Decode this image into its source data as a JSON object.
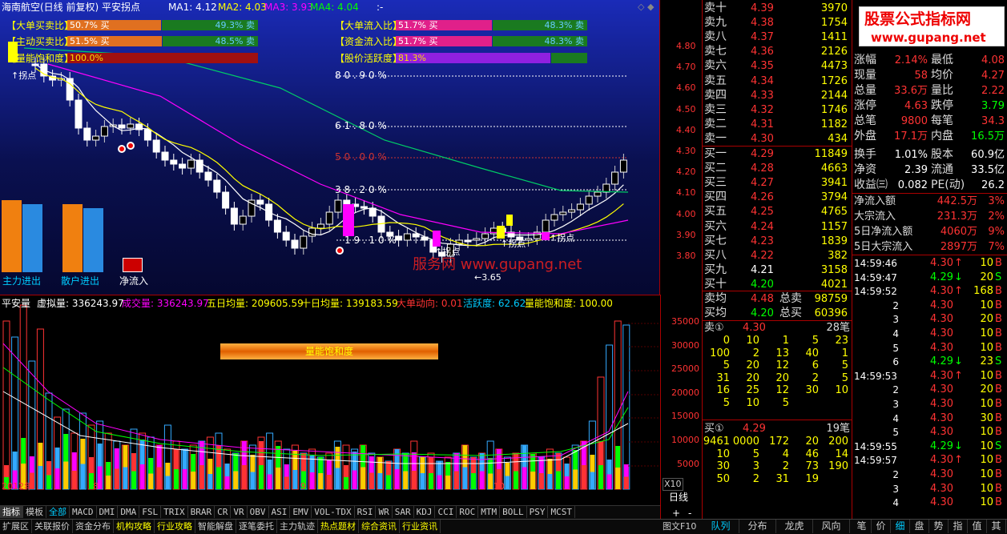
{
  "header": {
    "stock": "海南航空(日线 前复权) 平安拐点",
    "ma1": "MA1: 4.12",
    "ma2": "MA2: 4.03",
    "ma3": "MA3: 3.93",
    "ma4": "MA4: 4.04",
    "dash": ":-"
  },
  "indicators_left": [
    {
      "label": "【大单买卖比】",
      "bar": "50.7% 买",
      "right": "49.3% 卖"
    },
    {
      "label": "【主动买卖比】",
      "bar": "51.5% 买",
      "right": "48.5% 卖"
    },
    {
      "label": "【量能饱和度】",
      "bar": "100.0%",
      "right": ""
    }
  ],
  "indicators_right": [
    {
      "label": "【大单流入比】",
      "bar": "51.7% 买",
      "right": "48.3% 卖"
    },
    {
      "label": "【资金流入比】",
      "bar": "51.7% 买",
      "right": "48.3% 卖"
    },
    {
      "label": "【股价活跃度】",
      "bar": "81.3%",
      "right": ""
    }
  ],
  "price_axis": [
    "4.80",
    "4.70",
    "4.60",
    "4.50",
    "4.40",
    "4.30",
    "4.20",
    "4.10",
    "4.00",
    "3.90",
    "3.80"
  ],
  "fib": [
    "8 0 . 9 0 %",
    "6 1 . 8 0 %",
    "5 0 . 0 0 %",
    "3 8 . 2 0 %",
    "1 9 . 1 0 %"
  ],
  "annotations": {
    "turn1": "↑拐点",
    "turn2": "↑拐点",
    "turn3": "↑拐点",
    "turn4": "↑拐点",
    "low": "3.65"
  },
  "legend_bars": [
    "主力进出",
    "散户进出",
    "净流入"
  ],
  "watermark1": "服务网 www.gupang.net",
  "vol_header": {
    "name": "平安量",
    "v1": "虚拟量: 336243.97",
    "v2": "成交量: 336243.97",
    "v3": "五日均量: 209605.59",
    "v4": "十日均量: 139183.59",
    "v5": "大单动向: 0.01",
    "v6": "活跃度: 62.62",
    "v7": "量能饱和度: 100.00"
  },
  "saturation_label": "量能饱和度",
  "vol_axis": [
    "35000",
    "30000",
    "25000",
    "20000",
    "15000",
    "10000",
    "5000"
  ],
  "x10": "X10",
  "date_axis": {
    "y2012": "2012年",
    "m8": "8",
    "m9": "9",
    "m10": "10"
  },
  "period": "日线",
  "plus_minus": [
    "+",
    "-"
  ],
  "tabs_bottom1": [
    "指标",
    "模板",
    "全部",
    "MACD",
    "DMI",
    "DMA",
    "FSL",
    "TRIX",
    "BRAR",
    "CR",
    "VR",
    "OBV",
    "ASI",
    "EMV",
    "VOL-TDX",
    "RSI",
    "WR",
    "SAR",
    "KDJ",
    "CCI",
    "ROC",
    "MTM",
    "BOLL",
    "PSY",
    "MCST"
  ],
  "tabs_bottom2": [
    "扩展区",
    "关联报价",
    "资金分布",
    "机构攻略",
    "行业攻略",
    "智能解盘",
    "逐笔委托",
    "主力轨迹",
    "热点题材",
    "综合资讯",
    "行业资讯"
  ],
  "tufei": "图文F10",
  "tabs_right": [
    "队列",
    "分布",
    "龙虎",
    "风向"
  ],
  "tabs_far": [
    "笔",
    "价",
    "细",
    "盘",
    "势",
    "指",
    "值",
    "其"
  ],
  "asks": [
    {
      "n": "卖十",
      "p": "4.39",
      "v": "3970"
    },
    {
      "n": "卖九",
      "p": "4.38",
      "v": "1754"
    },
    {
      "n": "卖八",
      "p": "4.37",
      "v": "1411"
    },
    {
      "n": "卖七",
      "p": "4.36",
      "v": "2126"
    },
    {
      "n": "卖六",
      "p": "4.35",
      "v": "4473"
    },
    {
      "n": "卖五",
      "p": "4.34",
      "v": "1726"
    },
    {
      "n": "卖四",
      "p": "4.33",
      "v": "2144"
    },
    {
      "n": "卖三",
      "p": "4.32",
      "v": "1746"
    },
    {
      "n": "卖二",
      "p": "4.31",
      "v": "1182"
    },
    {
      "n": "卖一",
      "p": "4.30",
      "v": "434"
    }
  ],
  "bids": [
    {
      "n": "买一",
      "p": "4.29",
      "v": "11849"
    },
    {
      "n": "买二",
      "p": "4.28",
      "v": "4663"
    },
    {
      "n": "买三",
      "p": "4.27",
      "v": "3941"
    },
    {
      "n": "买四",
      "p": "4.26",
      "v": "3794"
    },
    {
      "n": "买五",
      "p": "4.25",
      "v": "4765"
    },
    {
      "n": "买六",
      "p": "4.24",
      "v": "1157"
    },
    {
      "n": "买七",
      "p": "4.23",
      "v": "1839"
    },
    {
      "n": "买八",
      "p": "4.22",
      "v": "382"
    },
    {
      "n": "买九",
      "p": "4.21",
      "v": "3158"
    },
    {
      "n": "买十",
      "p": "4.20",
      "v": "4021"
    }
  ],
  "avg": [
    {
      "n": "卖均",
      "p": "4.48",
      "k": "总卖",
      "v": "98759"
    },
    {
      "n": "买均",
      "p": "4.20",
      "k": "总买",
      "v": "60396"
    }
  ],
  "ask1_queue": {
    "label": "卖①",
    "price": "4.30",
    "count": "28笔",
    "rows": [
      [
        "0",
        "10",
        "1",
        "5",
        "23"
      ],
      [
        "100",
        "2",
        "13",
        "40",
        "1"
      ],
      [
        "5",
        "20",
        "12",
        "6",
        "5"
      ],
      [
        "31",
        "20",
        "20",
        "2",
        "5"
      ],
      [
        "16",
        "25",
        "12",
        "30",
        "10"
      ],
      [
        "5",
        "10",
        "5",
        "",
        ""
      ]
    ]
  },
  "bid1_queue": {
    "label": "买①",
    "price": "4.29",
    "count": "19笔",
    "rows": [
      [
        "9461",
        "0000",
        "172",
        "20",
        "200"
      ],
      [
        "10",
        "5",
        "4",
        "46",
        "14"
      ],
      [
        "30",
        "3",
        "2",
        "73",
        "190"
      ],
      [
        "50",
        "2",
        "31",
        "19",
        ""
      ]
    ]
  },
  "stats": [
    {
      "k": "涨幅",
      "v": "2.14%",
      "k2": "最低",
      "v2": "4.08"
    },
    {
      "k": "现量",
      "v": "58",
      "k2": "均价",
      "v2": "4.27"
    },
    {
      "k": "总量",
      "v": "33.6万",
      "k2": "量比",
      "v2": "2.22"
    },
    {
      "k": "涨停",
      "v": "4.63",
      "k2": "跌停",
      "v2": "3.79"
    },
    {
      "k": "总笔",
      "v": "9800",
      "k2": "每笔",
      "v2": "34.3"
    },
    {
      "k": "外盘",
      "v": "17.1万",
      "k2": "内盘",
      "v2": "16.5万"
    },
    {
      "k": "换手",
      "v": "1.01%",
      "k2": "股本",
      "v2": "60.9亿"
    },
    {
      "k": "净资",
      "v": "2.39",
      "k2": "流通",
      "v2": "33.5亿"
    },
    {
      "k": "收益㈢",
      "v": "0.082",
      "k2": "PE(动)",
      "v2": "26.2"
    }
  ],
  "flows": [
    {
      "k": "净流入额",
      "v": "442.5万",
      "p": "3%"
    },
    {
      "k": "大宗流入",
      "v": "231.3万",
      "p": "2%"
    },
    {
      "k": "5日净流入额",
      "v": "4060万",
      "p": "9%"
    },
    {
      "k": "5日大宗流入",
      "v": "2897万",
      "p": "7%"
    }
  ],
  "ticks": [
    {
      "t": "14:59:46",
      "p": "4.30",
      "a": "↑",
      "v": "10",
      "s": "B"
    },
    {
      "t": "14:59:47",
      "p": "4.29",
      "a": "↓",
      "v": "20",
      "s": "S"
    },
    {
      "t": "14:59:52",
      "p": "4.30",
      "a": "↑",
      "v": "168",
      "s": "B"
    },
    {
      "t": "2",
      "p": "4.30",
      "a": "",
      "v": "10",
      "s": "B"
    },
    {
      "t": "3",
      "p": "4.30",
      "a": "",
      "v": "20",
      "s": "B"
    },
    {
      "t": "4",
      "p": "4.30",
      "a": "",
      "v": "10",
      "s": "B"
    },
    {
      "t": "5",
      "p": "4.30",
      "a": "",
      "v": "10",
      "s": "B"
    },
    {
      "t": "6",
      "p": "4.29",
      "a": "↓",
      "v": "23",
      "s": "S"
    },
    {
      "t": "14:59:53",
      "p": "4.30",
      "a": "↑",
      "v": "10",
      "s": "B"
    },
    {
      "t": "2",
      "p": "4.30",
      "a": "",
      "v": "20",
      "s": "B"
    },
    {
      "t": "3",
      "p": "4.30",
      "a": "",
      "v": "10",
      "s": "B"
    },
    {
      "t": "4",
      "p": "4.30",
      "a": "",
      "v": "30",
      "s": "B"
    },
    {
      "t": "5",
      "p": "4.30",
      "a": "",
      "v": "10",
      "s": "B"
    },
    {
      "t": "14:59:55",
      "p": "4.29",
      "a": "↓",
      "v": "10",
      "s": "S"
    },
    {
      "t": "14:59:57",
      "p": "4.30",
      "a": "↑",
      "v": "10",
      "s": "B"
    },
    {
      "t": "2",
      "p": "4.30",
      "a": "",
      "v": "10",
      "s": "B"
    },
    {
      "t": "3",
      "p": "4.30",
      "a": "",
      "v": "10",
      "s": "B"
    },
    {
      "t": "4",
      "p": "4.30",
      "a": "",
      "v": "10",
      "s": "B"
    }
  ],
  "logo": {
    "line1": "股票公式指标网",
    "line2": "www.gupang.net"
  }
}
